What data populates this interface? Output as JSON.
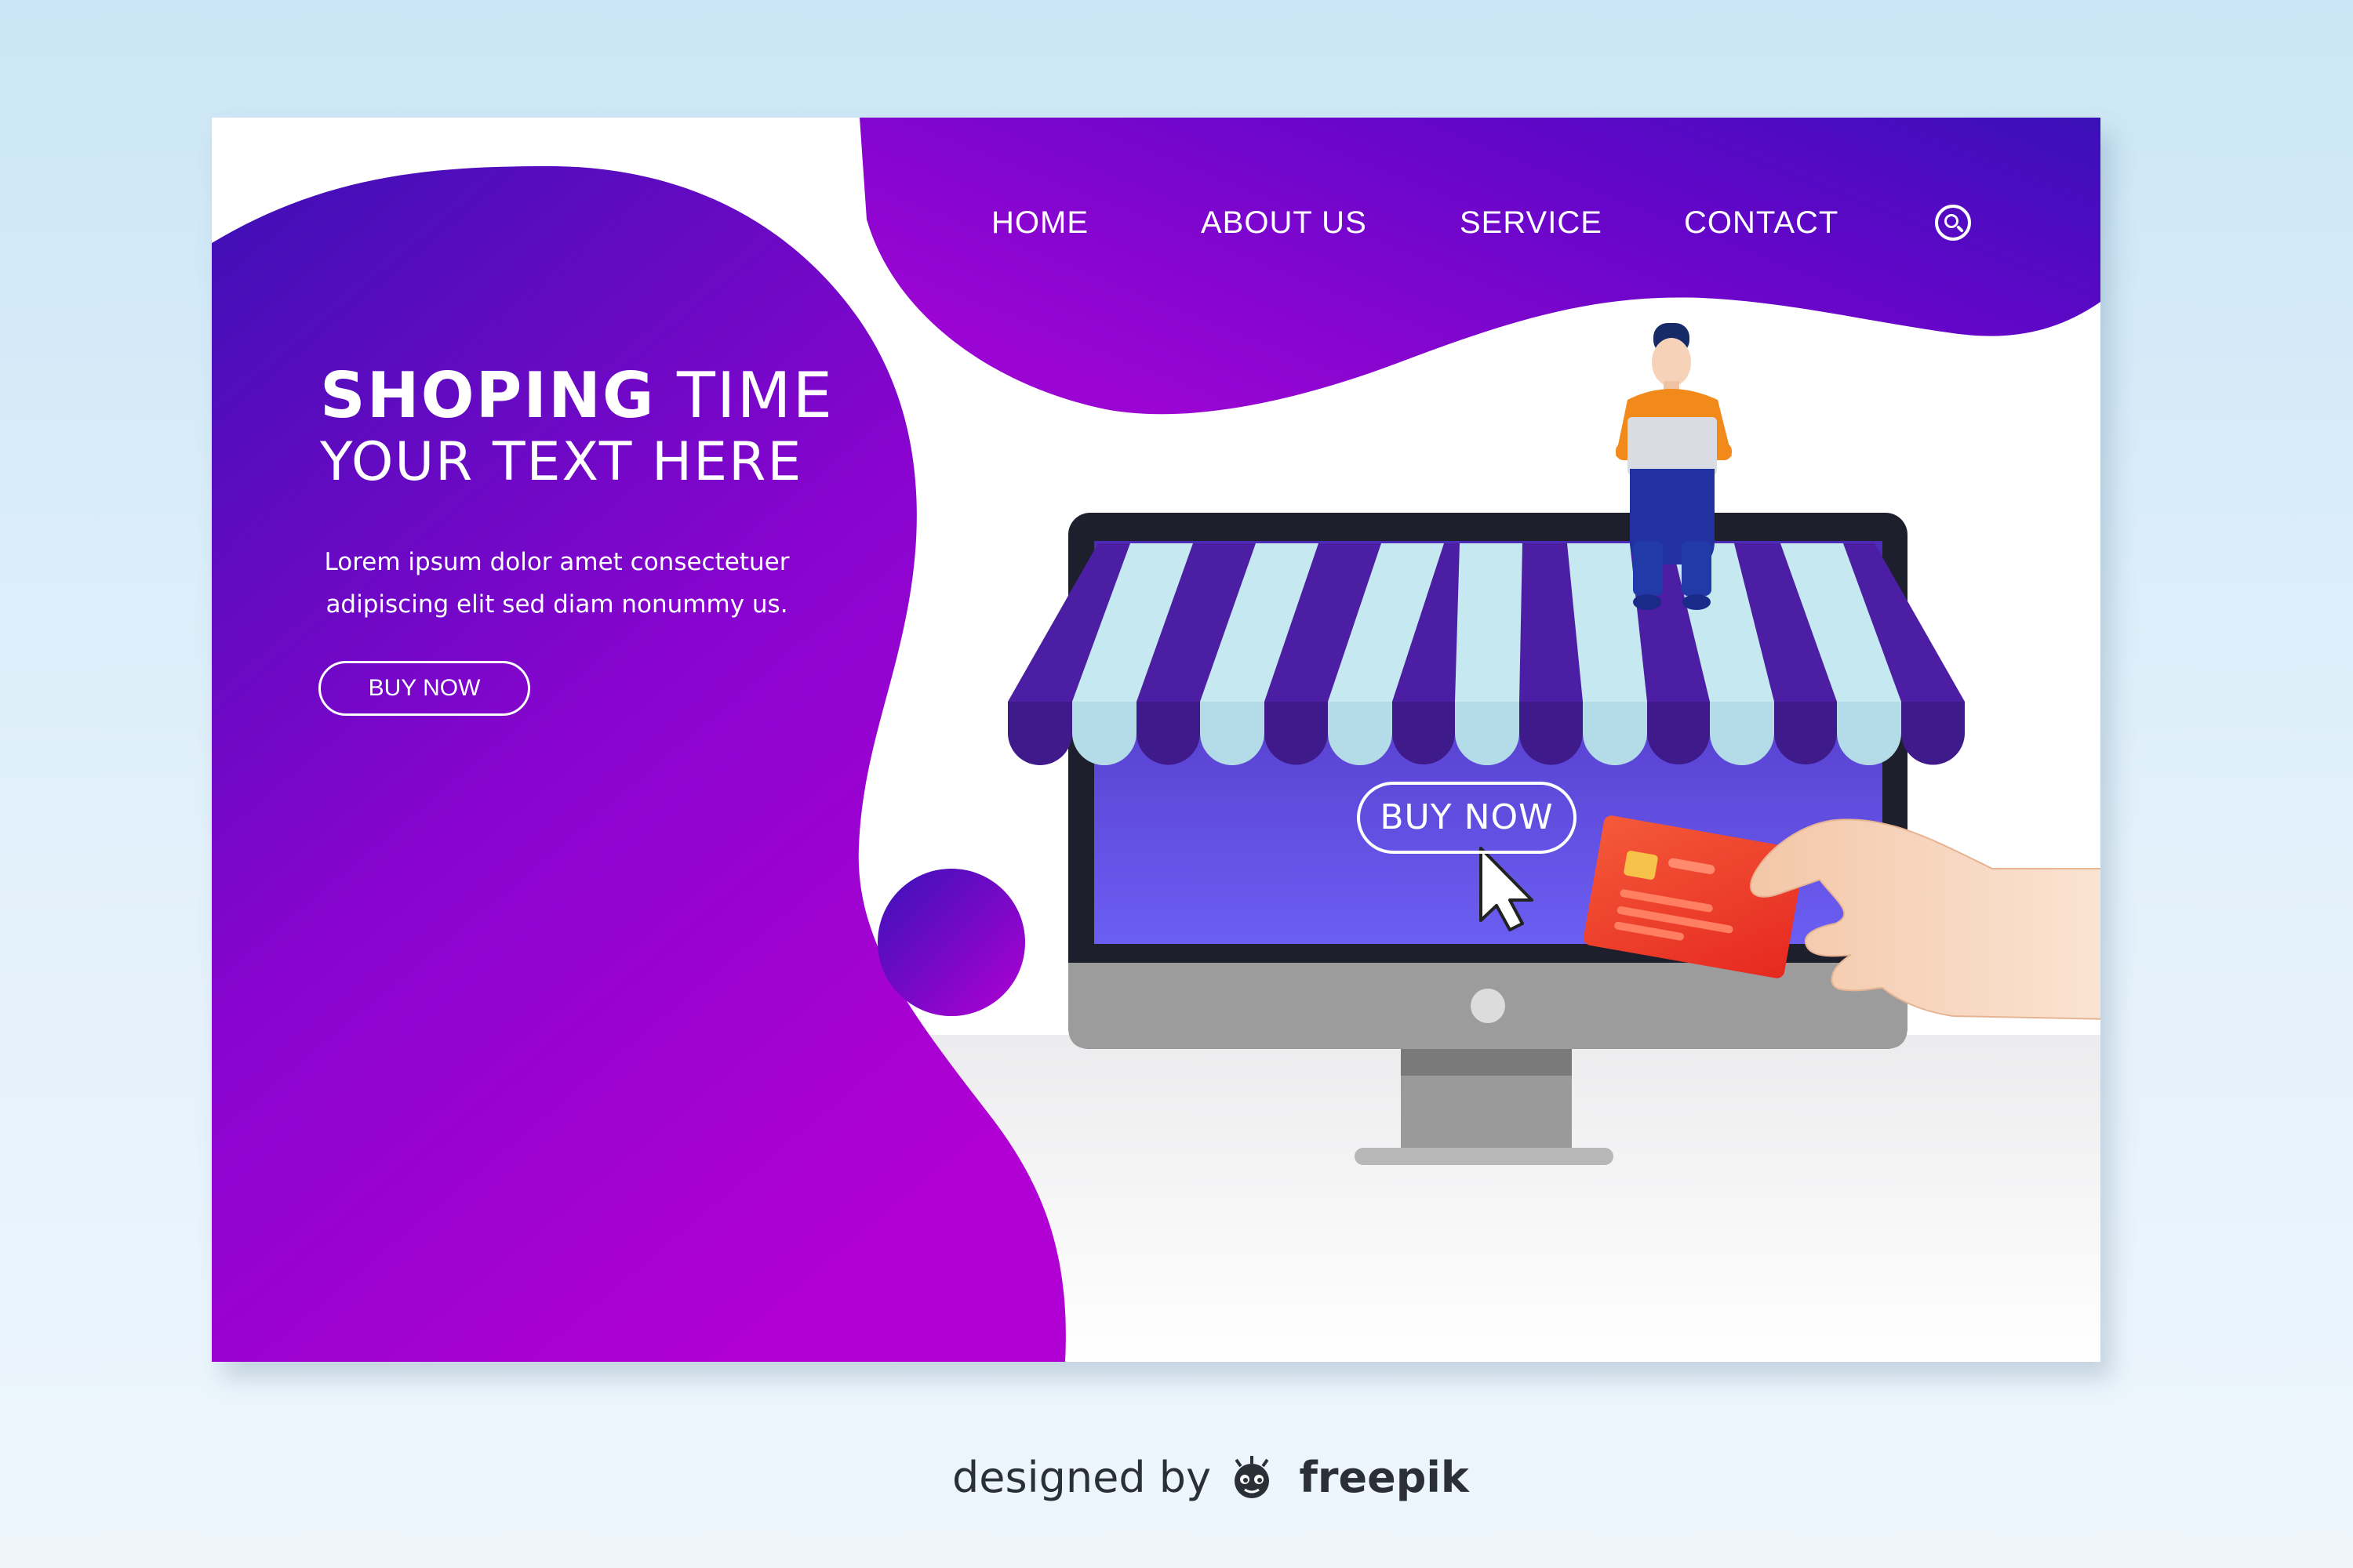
{
  "nav": {
    "home": "HOME",
    "about": "ABOUT US",
    "service": "SERVICE",
    "contact": "CONTACT"
  },
  "hero": {
    "title_bold": "SHOPING",
    "title_light": "TIME",
    "subtitle": "YOUR TEXT HERE",
    "body_line1": "Lorem ipsum dolor amet consectetuer",
    "body_line2": "adipiscing elit sed diam nonummy us.",
    "button_label": "BUY NOW"
  },
  "screen": {
    "button_label": "BUY NOW"
  },
  "credit": {
    "prefix": "designed by",
    "brand": "freepik"
  },
  "icons": {
    "search": "search-icon",
    "cursor": "mouse-pointer-icon",
    "card": "credit-card-icon",
    "logo": "freepik-logo-icon"
  },
  "colors": {
    "purple_dark": "#3f0fb8",
    "purple_light": "#a400d6",
    "awning_stripe": "#4a1fa0",
    "awning_light": "#c6e8f0",
    "card_red": "#ef3b2c",
    "shirt_orange": "#f28a1b"
  }
}
